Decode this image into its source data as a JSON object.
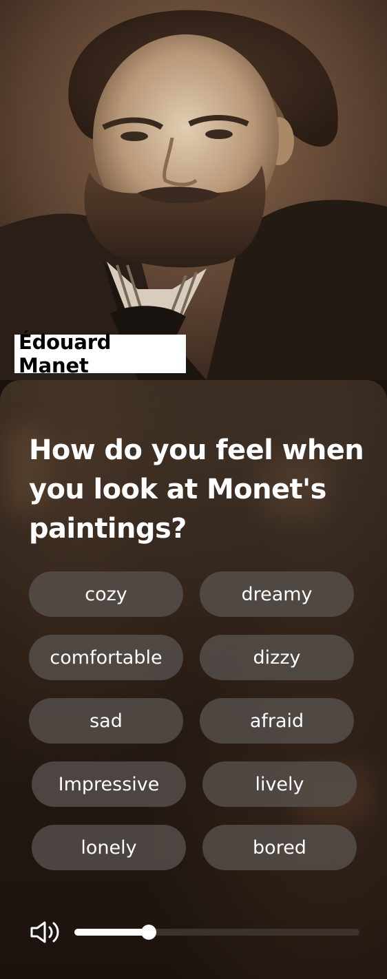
{
  "portrait": {
    "caption": "Édouard Manet"
  },
  "quiz": {
    "question": "How do you feel when you look at Monet's paintings?",
    "options": [
      "cozy",
      "dreamy",
      "comfortable",
      "dizzy",
      "sad",
      "afraid",
      "Impressive",
      "lively",
      "lonely",
      "bored"
    ]
  },
  "audio": {
    "icon": "speaker-icon",
    "volume": 0.26
  },
  "colors": {
    "chip_background": "#58524e",
    "panel_background": "#261b15",
    "slider_fill": "#ffffff",
    "slider_track": "#3b322d"
  }
}
